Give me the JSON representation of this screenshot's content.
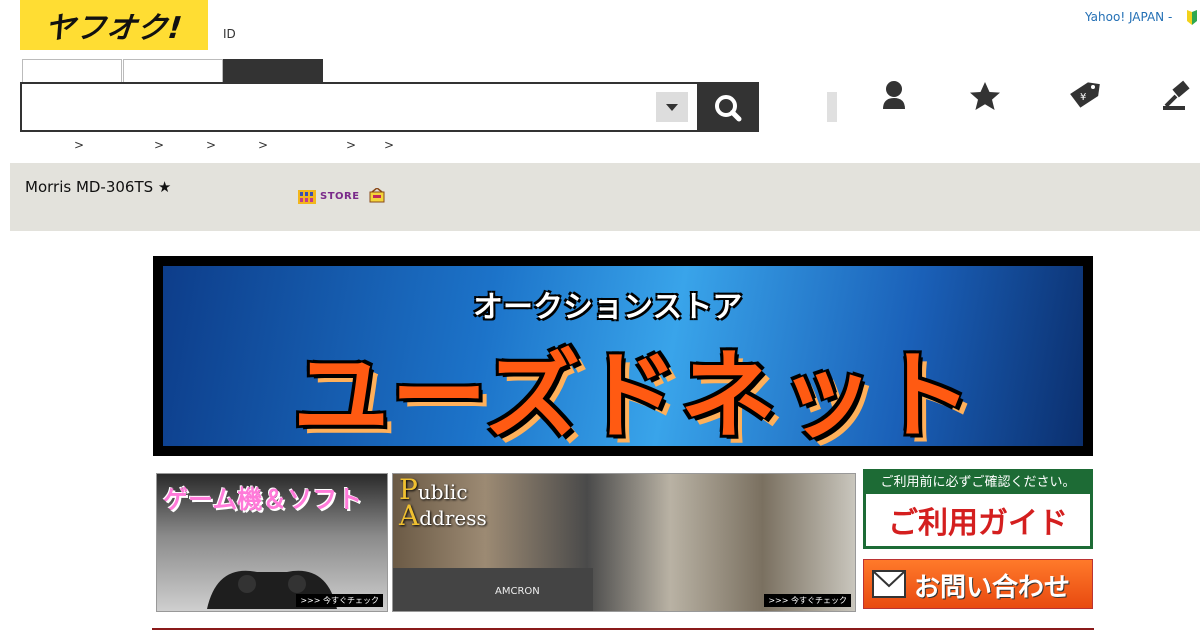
{
  "header": {
    "logo": "ヤフオク!",
    "id_label": "ID",
    "yahoo_link": "Yahoo! JAPAN -"
  },
  "search": {
    "placeholder": ""
  },
  "breadcrumb": [
    ">",
    ">",
    ">",
    ">",
    ">",
    ">"
  ],
  "item": {
    "title": "Morris MD-306TS ★",
    "store_label": "STORE"
  },
  "banner": {
    "subtitle": "オークションストア",
    "main": "ユーズドネット"
  },
  "sub_banners": {
    "game_title": "ゲーム機＆ソフト",
    "game_check": ">>> 今すぐチェック",
    "pa_line1_cap": "P",
    "pa_line1": "ublic",
    "pa_line2_cap": "A",
    "pa_line2": "ddress",
    "pa_brand": "AMCRON",
    "pa_check": ">>> 今すぐチェック",
    "guide_top": "ご利用前に必ずご確認ください。",
    "guide_main": "ご利用ガイド",
    "contact": "お問い合わせ"
  },
  "colors": {
    "logo_bg": "#ffdd33",
    "title_bar_bg": "#e3e2dc",
    "link": "#2470b5",
    "guide_green": "#1d6b35",
    "guide_red": "#d41f1f",
    "contact_orange": "#e84a10"
  },
  "icons": [
    "search-icon",
    "user-icon",
    "star-icon",
    "price-tag-icon",
    "gavel-icon"
  ]
}
